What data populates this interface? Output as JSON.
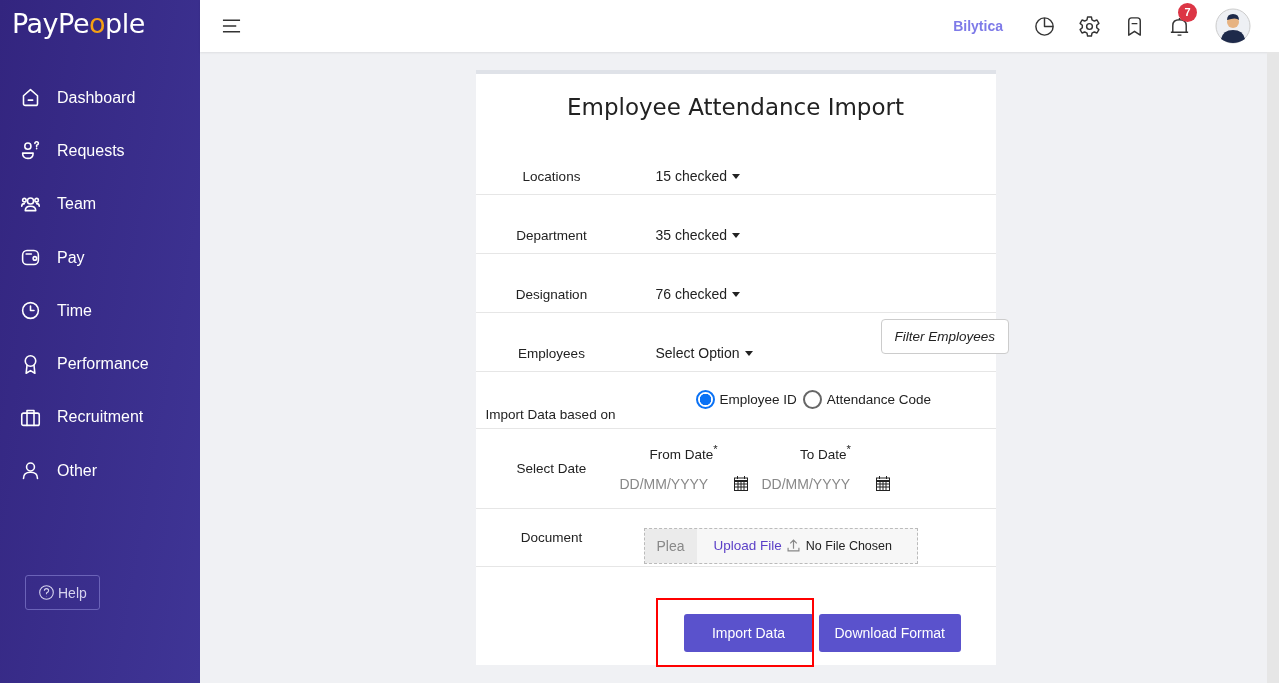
{
  "logo": [
    {
      "text": "PayPe",
      "accent": false
    },
    {
      "text": "o",
      "accent": true
    },
    {
      "text": "ple",
      "accent": false
    }
  ],
  "sidebar": {
    "items": [
      {
        "label": "Dashboard",
        "kind": "home"
      },
      {
        "label": "Requests",
        "kind": "request"
      },
      {
        "label": "Team",
        "kind": "team"
      },
      {
        "label": "Pay",
        "kind": "wallet"
      },
      {
        "label": "Time",
        "kind": "clock"
      },
      {
        "label": "Performance",
        "kind": "award"
      },
      {
        "label": "Recruitment",
        "kind": "briefcase"
      },
      {
        "label": "Other",
        "kind": "person"
      }
    ],
    "help": "Help"
  },
  "topbar": {
    "brand": "Bilytica",
    "notifications": "7"
  },
  "form": {
    "title": "Employee Attendance Import",
    "rows": [
      {
        "kind": "dropdown",
        "label": "Locations",
        "value": "15 checked"
      },
      {
        "kind": "dropdown",
        "label": "Department",
        "value": "35 checked"
      },
      {
        "kind": "dropdown",
        "label": "Designation",
        "value": "76 checked"
      },
      {
        "kind": "dropdown",
        "label": "Employees",
        "value": "Select Option",
        "button": "Filter Employees"
      },
      {
        "kind": "radio",
        "label": "Import Data based on",
        "options": [
          {
            "label": "Employee ID",
            "selected": true
          },
          {
            "label": "Attendance Code",
            "selected": false
          }
        ]
      },
      {
        "kind": "dates",
        "label": "Select Date",
        "dates": [
          {
            "label": "From Date$^{*}$",
            "placeholder": "DD/MM/YYYY"
          },
          {
            "label": "To Date$^{*}$",
            "placeholder": "DD/MM/YYYY"
          }
        ]
      },
      {
        "kind": "file",
        "label": "Document",
        "placeholder": "Plea",
        "button": "Upload File",
        "status": "No File Chosen"
      }
    ],
    "buttons": [
      {
        "label": "Import Data",
        "highlighted": true
      },
      {
        "label": "Download Format",
        "highlighted": false
      }
    ]
  }
}
